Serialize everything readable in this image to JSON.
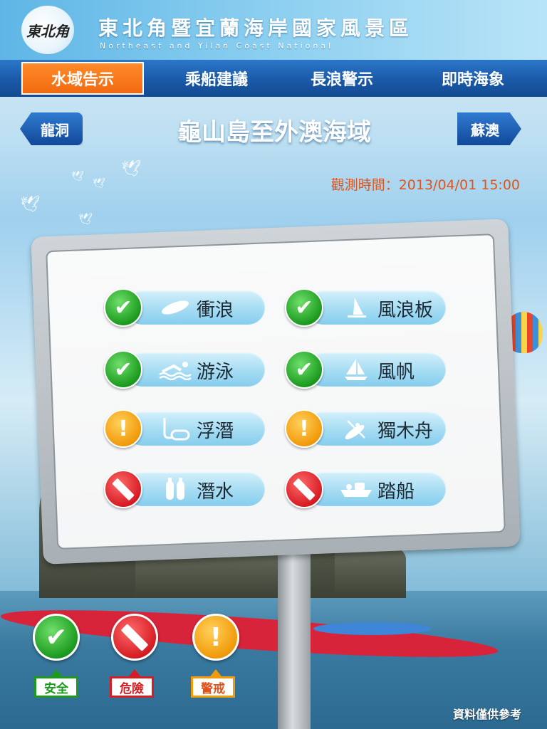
{
  "header": {
    "logo_text": "東北角",
    "title": "東北角暨宜蘭海岸國家風景區",
    "subtitle": "Northeast and Yilan Coast National"
  },
  "nav": {
    "tabs": [
      {
        "label": "水域告示",
        "active": true
      },
      {
        "label": "乘船建議",
        "active": false
      },
      {
        "label": "長浪警示",
        "active": false
      },
      {
        "label": "即時海象",
        "active": false
      }
    ]
  },
  "area": {
    "prev_label": "龍洞",
    "title": "龜山島至外澳海域",
    "next_label": "蘇澳",
    "observation_time": "觀測時間：2013/04/01 15:00"
  },
  "activities": [
    {
      "label": "衝浪",
      "status": "safe",
      "icon": "surfboard-icon"
    },
    {
      "label": "風浪板",
      "status": "safe",
      "icon": "windsurf-icon"
    },
    {
      "label": "游泳",
      "status": "safe",
      "icon": "swimmer-icon"
    },
    {
      "label": "風帆",
      "status": "safe",
      "icon": "sailboat-icon"
    },
    {
      "label": "浮潛",
      "status": "warn",
      "icon": "snorkel-icon"
    },
    {
      "label": "獨木舟",
      "status": "warn",
      "icon": "kayak-icon"
    },
    {
      "label": "潛水",
      "status": "danger",
      "icon": "scuba-tank-icon"
    },
    {
      "label": "踏船",
      "status": "danger",
      "icon": "pedal-boat-icon"
    }
  ],
  "legend": {
    "safe": "安全",
    "danger": "危險",
    "warn": "警戒"
  },
  "colors": {
    "safe": "#1c9a1f",
    "warn": "#f19a0b",
    "danger": "#d61c24",
    "nav": "#1a5aa8",
    "active_tab": "#f26a0f",
    "time_text": "#e0541a"
  },
  "footer": {
    "note": "資料僅供參考"
  }
}
